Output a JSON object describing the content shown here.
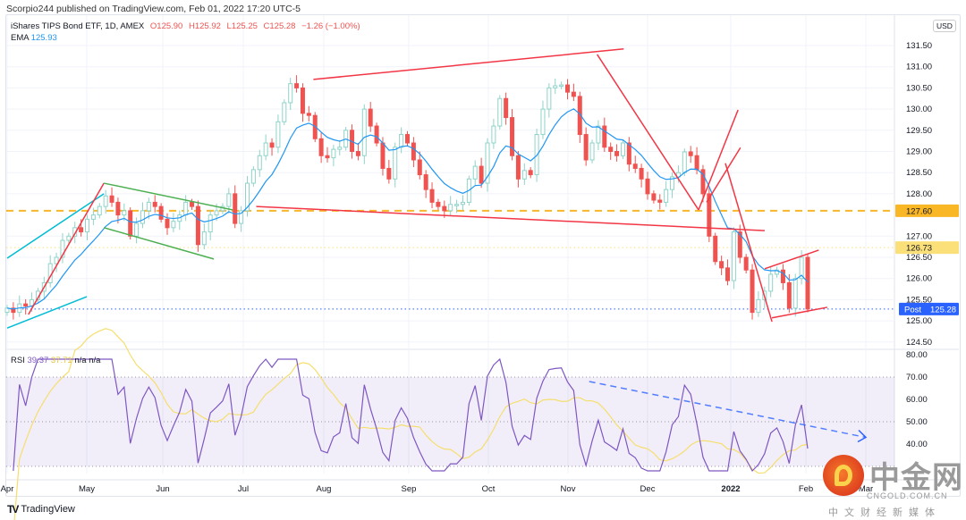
{
  "header": {
    "published": "Scorpio244 published on TradingView.com, Feb 01, 2022 17:20 UTC-5"
  },
  "legend": {
    "symbol": "iShares TIPS Bond ETF, 1D, AMEX",
    "open": "O125.90",
    "high": "H125.92",
    "low": "L125.25",
    "close": "C125.28",
    "change": "−1.26 (−1.00%)",
    "ema_label": "EMA",
    "ema_value": "125.93",
    "rsi_label": "RSI",
    "rsi_value": "39.37",
    "rsi_ma_value": "37.71",
    "na1": "n/a",
    "na2": "n/a"
  },
  "colors": {
    "up": "#26a69a",
    "down": "#ef5350",
    "ema": "#2196f3",
    "rsi": "#7e57c2",
    "rsi_ma": "#f5de6e",
    "drawing_red": "#f23645",
    "drawing_green": "#4caf50",
    "drawing_cyan": "#00bcd4",
    "level_orange": "#f9b625",
    "level_yellow": "#fbe07a",
    "post_blue": "#2962ff"
  },
  "axis": {
    "currency": "USD",
    "price_ticks": [
      "131.50",
      "131.00",
      "130.50",
      "130.00",
      "129.50",
      "129.00",
      "128.50",
      "128.00",
      "127.00",
      "126.50",
      "126.00",
      "125.50",
      "125.00",
      "124.50"
    ],
    "rsi_ticks": [
      "80.00",
      "70.00",
      "60.00",
      "50.00",
      "40.00"
    ],
    "months": [
      {
        "label": "Apr",
        "date": "2021-04-01"
      },
      {
        "label": "May",
        "date": "2021-05-01"
      },
      {
        "label": "Jun",
        "date": "2021-06-01"
      },
      {
        "label": "Jul",
        "date": "2021-07-01"
      },
      {
        "label": "Aug",
        "date": "2021-08-01"
      },
      {
        "label": "Sep",
        "date": "2021-09-01"
      },
      {
        "label": "Oct",
        "date": "2021-10-01"
      },
      {
        "label": "Nov",
        "date": "2021-11-01"
      },
      {
        "label": "Dec",
        "date": "2021-12-01"
      },
      {
        "label": "2022",
        "date": "2022-01-01"
      },
      {
        "label": "Feb",
        "date": "2022-02-01"
      },
      {
        "label": "Mar",
        "date": "2022-03-01"
      }
    ]
  },
  "price_labels": {
    "level1": "127.60",
    "level2": "126.73",
    "post_tag": "Post",
    "post_price": "125.28"
  },
  "chart_data": {
    "type": "candlestick",
    "date_range": [
      "2021-04-01",
      "2022-02-01"
    ],
    "ylim": [
      124.3,
      131.85
    ],
    "rsi_ylim": [
      25,
      82
    ],
    "rsi_bands": [
      30,
      50,
      70
    ],
    "ema_last": 125.93,
    "rsi_last": 39.37,
    "rsi_ma_last": 37.71,
    "closes": [
      125.3,
      125.2,
      125.4,
      125.35,
      125.5,
      125.7,
      125.9,
      126.35,
      126.5,
      126.9,
      127.0,
      127.2,
      127.1,
      127.4,
      127.5,
      127.7,
      127.95,
      127.8,
      127.5,
      127.6,
      127.0,
      127.3,
      127.6,
      127.8,
      127.7,
      127.4,
      127.2,
      127.35,
      127.5,
      127.8,
      127.7,
      126.8,
      127.1,
      127.5,
      127.6,
      127.7,
      128.0,
      127.3,
      127.6,
      128.25,
      128.57,
      128.9,
      129.2,
      129.1,
      129.7,
      130.15,
      130.6,
      130.5,
      129.9,
      129.85,
      129.3,
      128.9,
      128.85,
      129.05,
      129.1,
      129.5,
      129.0,
      128.9,
      130.0,
      129.6,
      129.2,
      128.6,
      128.35,
      129.1,
      129.4,
      129.2,
      128.8,
      128.45,
      128.1,
      127.8,
      127.7,
      127.6,
      127.75,
      127.75,
      127.8,
      128.35,
      128.65,
      128.25,
      129.2,
      129.6,
      130.25,
      129.8,
      128.9,
      128.35,
      128.55,
      128.45,
      129.4,
      130.0,
      130.5,
      130.55,
      130.57,
      130.4,
      130.3,
      129.4,
      128.8,
      129.2,
      129.6,
      129.1,
      129.0,
      128.9,
      129.2,
      128.7,
      128.6,
      128.35,
      128.0,
      127.85,
      127.8,
      128.1,
      128.4,
      128.5,
      128.99,
      128.9,
      128.57,
      128.0,
      127.0,
      126.4,
      126.25,
      125.95,
      127.1,
      126.5,
      126.2,
      125.2,
      125.5,
      125.7,
      126.1,
      126.2,
      125.9,
      125.3,
      126.0,
      126.5,
      125.28
    ],
    "horizontal_levels": [
      {
        "price": 127.6,
        "style": "dashed",
        "color": "#f9b625"
      },
      {
        "price": 126.73,
        "style": "dotted",
        "color": "#fbe07a"
      },
      {
        "price": 125.28,
        "style": "dotted",
        "color": "#2962ff"
      }
    ],
    "trendlines": [
      {
        "name": "cyan-upper",
        "color": "#00bcd4",
        "from": [
          "2021-04-01",
          126.48
        ],
        "to": [
          "2021-05-08",
          128.0
        ]
      },
      {
        "name": "cyan-lower",
        "color": "#00bcd4",
        "from": [
          "2021-04-01",
          124.83
        ],
        "to": [
          "2021-05-01",
          125.57
        ]
      },
      {
        "name": "red-rally",
        "color": "#f23645",
        "from": [
          "2021-04-09",
          125.15
        ],
        "to": [
          "2021-05-08",
          128.25
        ]
      },
      {
        "name": "green-channel-upper",
        "color": "#4caf50",
        "from": [
          "2021-05-08",
          128.25
        ],
        "to": [
          "2021-06-27",
          127.62
        ]
      },
      {
        "name": "green-channel-lower",
        "color": "#4caf50",
        "from": [
          "2021-05-08",
          127.2
        ],
        "to": [
          "2021-06-20",
          126.46
        ]
      },
      {
        "name": "red-support",
        "color": "#f23645",
        "from": [
          "2021-07-06",
          127.7
        ],
        "to": [
          "2022-01-15",
          127.13
        ]
      },
      {
        "name": "red-resistance",
        "color": "#f23645",
        "from": [
          "2021-07-28",
          130.7
        ],
        "to": [
          "2021-11-22",
          131.42
        ]
      },
      {
        "name": "red-decline",
        "color": "#f23645",
        "from": [
          "2021-11-12",
          131.29
        ],
        "to": [
          "2021-12-20",
          127.62
        ]
      },
      {
        "name": "red-v-up-1",
        "color": "#f23645",
        "from": [
          "2021-12-20",
          127.62
        ],
        "to": [
          "2022-01-04",
          129.98
        ]
      },
      {
        "name": "red-v-up-2",
        "color": "#f23645",
        "from": [
          "2021-12-23",
          127.8
        ],
        "to": [
          "2022-01-05",
          129.09
        ]
      },
      {
        "name": "red-january-drop",
        "color": "#f23645",
        "from": [
          "2021-12-30",
          128.72
        ],
        "to": [
          "2022-01-18",
          124.98
        ]
      },
      {
        "name": "red-wedge-upper",
        "color": "#f23645",
        "from": [
          "2022-01-15",
          126.23
        ],
        "to": [
          "2022-02-07",
          126.67
        ]
      },
      {
        "name": "red-wedge-lower",
        "color": "#f23645",
        "from": [
          "2022-01-18",
          125.07
        ],
        "to": [
          "2022-02-11",
          125.32
        ]
      }
    ],
    "rsi_trendline": {
      "color": "#2962ff",
      "style": "dashed-arrow",
      "from": [
        "2021-11-09",
        68
      ],
      "to": [
        "2022-03-01",
        43
      ]
    }
  },
  "footer": {
    "brand": "TradingView"
  },
  "watermark": {
    "name": "中金网",
    "domain": "CNGOLD.COM.CN",
    "tagline": "中文财经新媒体"
  }
}
